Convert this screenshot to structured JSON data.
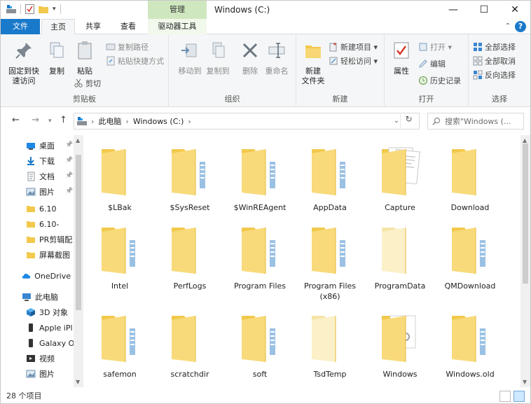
{
  "titlebar": {
    "context_tab": "管理",
    "title": "Windows (C:)",
    "minimize": "—",
    "maximize": "☐",
    "close": "✕"
  },
  "tabs": {
    "file": "文件",
    "home": "主页",
    "share": "共享",
    "view": "查看",
    "drive_tools": "驱动器工具",
    "help": "?"
  },
  "ribbon": {
    "clipboard": {
      "group_label": "剪贴板",
      "pin_label_1": "固定到快",
      "pin_label_2": "速访问",
      "copy": "复制",
      "paste": "粘贴",
      "copy_path": "复制路径",
      "paste_shortcut": "粘贴快捷方式",
      "cut": "剪切"
    },
    "organize": {
      "group_label": "组织",
      "move_to": "移动到",
      "copy_to": "复制到",
      "delete": "删除",
      "rename": "重命名"
    },
    "new": {
      "group_label": "新建",
      "new_folder_1": "新建",
      "new_folder_2": "文件夹",
      "new_item": "新建项目 ▾",
      "easy_access": "轻松访问 ▾"
    },
    "open": {
      "group_label": "打开",
      "properties": "属性",
      "open": "打开 ▾",
      "edit": "编辑",
      "history": "历史记录"
    },
    "select": {
      "group_label": "选择",
      "select_all": "全部选择",
      "select_none": "全部取消",
      "invert": "反向选择"
    }
  },
  "address": {
    "path_root": "此电脑",
    "path_drive": "Windows (C:)",
    "search_placeholder": "搜索\"Windows (..."
  },
  "navpane": {
    "items": [
      {
        "label": "桌面",
        "pinned": true
      },
      {
        "label": "下载",
        "pinned": true
      },
      {
        "label": "文档",
        "pinned": true
      },
      {
        "label": "图片",
        "pinned": true
      },
      {
        "label": "6.10",
        "pinned": false
      },
      {
        "label": "6.10-",
        "pinned": false
      },
      {
        "label": "PR剪辑配",
        "pinned": false
      },
      {
        "label": "屏幕截图",
        "pinned": false
      },
      {
        "label": "OneDrive",
        "pinned": false
      },
      {
        "label": "此电脑",
        "pinned": false
      },
      {
        "label": "3D 对象",
        "pinned": false
      },
      {
        "label": "Apple iPl",
        "pinned": false
      },
      {
        "label": "Galaxy O",
        "pinned": false
      },
      {
        "label": "视频",
        "pinned": false
      },
      {
        "label": "图片",
        "pinned": false
      }
    ]
  },
  "folders": [
    {
      "name": "$LBak",
      "type": "plain"
    },
    {
      "name": "$SysReset",
      "type": "docs"
    },
    {
      "name": "$WinREAgent",
      "type": "docs"
    },
    {
      "name": "AppData",
      "type": "docs"
    },
    {
      "name": "Capture",
      "type": "papers"
    },
    {
      "name": "Download",
      "type": "plain"
    },
    {
      "name": "Intel",
      "type": "docs"
    },
    {
      "name": "PerfLogs",
      "type": "plain"
    },
    {
      "name": "Program Files",
      "type": "docs"
    },
    {
      "name": "Program Files (x86)",
      "type": "docs"
    },
    {
      "name": "ProgramData",
      "type": "light"
    },
    {
      "name": "QMDownload",
      "type": "docs"
    },
    {
      "name": "safemon",
      "type": "docs"
    },
    {
      "name": "scratchdir",
      "type": "plain"
    },
    {
      "name": "soft",
      "type": "docs"
    },
    {
      "name": "TsdTemp",
      "type": "light"
    },
    {
      "name": "Windows",
      "type": "gears"
    },
    {
      "name": "Windows.old",
      "type": "docs"
    }
  ],
  "status": {
    "item_count": "28 个项目"
  },
  "colors": {
    "accent": "#1979ca",
    "folder": "#f7d774",
    "context_tab": "#cfe7bf"
  }
}
